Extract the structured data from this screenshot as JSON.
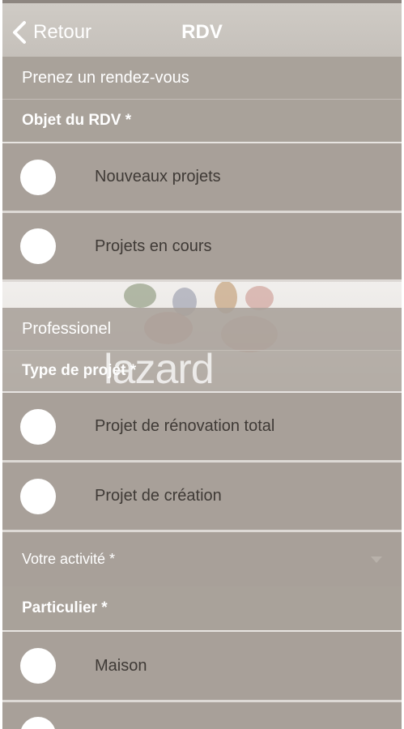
{
  "header": {
    "back_label": "Retour",
    "title": "RDV"
  },
  "brand": {
    "logo_text": "lazard"
  },
  "form": {
    "section_rdv": "Prenez un rendez-vous",
    "objet_label": "Objet du RDV *",
    "objet_options": [
      "Nouveaux projets",
      "Projets en cours"
    ],
    "section_pro": "Professionel",
    "type_label": "Type de projet *",
    "type_options": [
      "Projet de rénovation total",
      "Projet de création"
    ],
    "activite_select": "Votre activité *",
    "particulier_label": "Particulier *",
    "particulier_options": [
      "Maison"
    ]
  },
  "colors": {
    "header_bg": "#c9c4be",
    "row_bg": "#a8a099",
    "text_white": "#ffffff",
    "option_text": "#3f3a36"
  }
}
